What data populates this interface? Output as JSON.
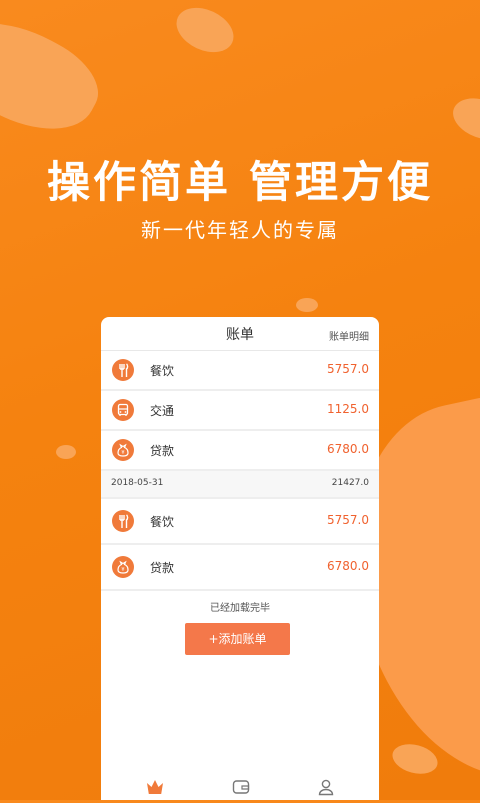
{
  "hero": {
    "headline": "操作简单 管理方便",
    "subline": "新一代年轻人的专属"
  },
  "panel": {
    "title": "账单",
    "detail_link": "账单明细"
  },
  "bills_top": [
    {
      "icon": "fork-knife-icon",
      "label": "餐饮",
      "amount": "5757.0"
    },
    {
      "icon": "bus-icon",
      "label": "交通",
      "amount": "1125.0"
    },
    {
      "icon": "money-bag-icon",
      "label": "贷款",
      "amount": "6780.0"
    }
  ],
  "date_group": {
    "date": "2018-05-31",
    "total": "21427.0"
  },
  "bills_group": [
    {
      "icon": "fork-knife-icon",
      "label": "餐饮",
      "amount": "5757.0"
    },
    {
      "icon": "money-bag-icon",
      "label": "贷款",
      "amount": "6780.0"
    }
  ],
  "footer": {
    "loaded_text": "已经加载完毕",
    "add_button": "+添加账单"
  },
  "tabs": [
    {
      "icon": "crown-icon",
      "active": true
    },
    {
      "icon": "wallet-icon",
      "active": false
    },
    {
      "icon": "user-icon",
      "active": false
    }
  ],
  "colors": {
    "background": "#f5820f",
    "accent": "#f4784a",
    "amount": "#f0622f"
  }
}
